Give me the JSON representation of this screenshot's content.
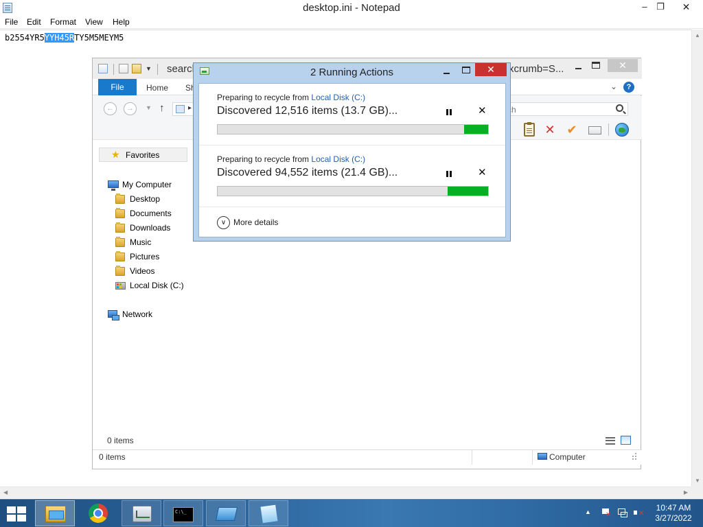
{
  "notepad": {
    "title": "desktop.ini - Notepad",
    "menu": [
      "File",
      "Edit",
      "Format",
      "View",
      "Help"
    ],
    "content_before": "b2554YR5",
    "content_selected": "YYH45R",
    "content_after": "TY5M5MEYM5",
    "minimize": "‒",
    "maximize": "❐",
    "close": "✕"
  },
  "explorer": {
    "title_left": "search",
    "title_right": "xcrumb=S...",
    "close": "✕",
    "tabs": {
      "file": "File",
      "home": "Home",
      "share": "Sh"
    },
    "help": "?",
    "search_placeholder": "ch",
    "favorites": "Favorites",
    "tree": {
      "my_computer": "My Computer",
      "desktop": "Desktop",
      "documents": "Documents",
      "downloads": "Downloads",
      "music": "Music",
      "pictures": "Pictures",
      "videos": "Videos",
      "local_disk": "Local Disk (C:)",
      "network": "Network"
    },
    "items_count": "0 items",
    "status_count": "0 items",
    "status_location": "Computer"
  },
  "dialog": {
    "title": "2 Running Actions",
    "close": "✕",
    "operations": [
      {
        "prefix": "Preparing to recycle from ",
        "source": "Local Disk (C:)",
        "status": "Discovered 12,516 items (13.7 GB)...",
        "progress": 0.91
      },
      {
        "prefix": "Preparing to recycle from ",
        "source": "Local Disk (C:)",
        "status": "Discovered 94,552 items (21.4 GB)...",
        "progress": 0.85
      }
    ],
    "cancel_glyph": "✕",
    "more_glyph": "∨",
    "more_details": "More details"
  },
  "taskbar": {
    "cmd_text": "C:\\_",
    "time": "10:47 AM",
    "date": "3/27/2022"
  },
  "colors": {
    "accent": "#1979ca",
    "progress_fill": "#06b025",
    "dialog_close": "#c7322f",
    "selection": "#3399ff"
  }
}
